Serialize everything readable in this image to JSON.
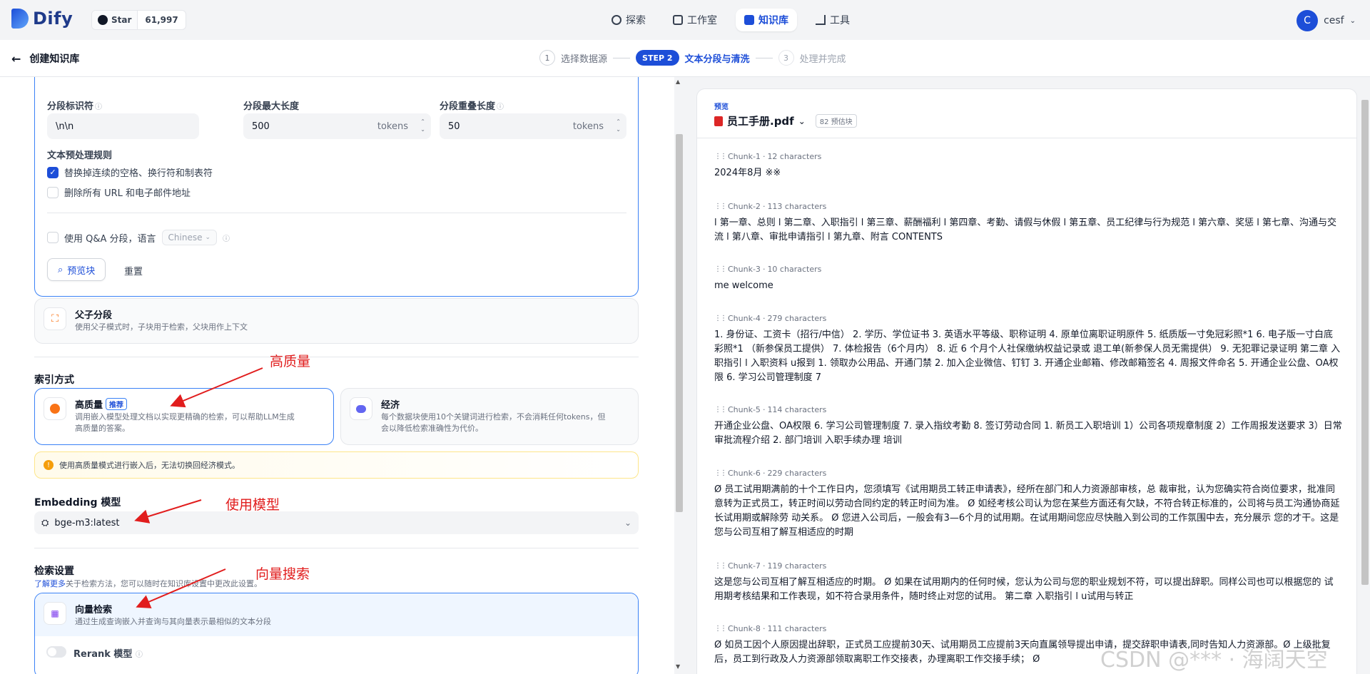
{
  "header": {
    "logo": "Dify",
    "github_star": "Star",
    "github_count": "61,997",
    "nav": [
      {
        "label": "探索",
        "icon": "compass-icon"
      },
      {
        "label": "工作室",
        "icon": "robot-icon"
      },
      {
        "label": "知识库",
        "icon": "book-icon",
        "active": true
      },
      {
        "label": "工具",
        "icon": "hammer-icon"
      }
    ],
    "user_initial": "C",
    "user_name": "cesf"
  },
  "subheader": {
    "back_label": "创建知识库",
    "steps": [
      {
        "num": "1",
        "label": "选择数据源"
      },
      {
        "pill": "STEP 2",
        "label": "文本分段与清洗"
      },
      {
        "num": "3",
        "label": "处理并完成"
      }
    ]
  },
  "segmentation": {
    "delimiter_label": "分段标识符",
    "delimiter_value": "\\n\\n",
    "max_length_label": "分段最大长度",
    "max_length_value": "500",
    "overlap_label": "分段重叠长度",
    "overlap_value": "50",
    "unit": "tokens",
    "rules_title": "文本预处理规则",
    "rule_1": "替换掉连续的空格、换行符和制表符",
    "rule_2": "删除所有 URL 和电子邮件地址",
    "qa_label": "使用 Q&A 分段，语言",
    "qa_lang": "Chinese",
    "preview_button": "预览块",
    "reset_button": "重置"
  },
  "parent_child": {
    "title": "父子分段",
    "desc": "使用父子模式时，子块用于检索，父块用作上下文"
  },
  "index": {
    "section_title": "索引方式",
    "high_title": "高质量",
    "high_badge": "推荐",
    "high_desc_1": "调用嵌入模型处理文档以实现更精确的检索，可以帮助LLM生成",
    "high_desc_2": "高质量的答案。",
    "eco_title": "经济",
    "eco_desc_1": "每个数据块使用10个关键词进行检索，不会消耗任何tokens，但",
    "eco_desc_2": "会以降低检索准确性为代价。",
    "warning": "使用高质量模式进行嵌入后，无法切换回经济模式。"
  },
  "embedding": {
    "section_title": "Embedding 模型",
    "model": "bge-m3:latest"
  },
  "retrieval": {
    "section_title": "检索设置",
    "hint_link": "了解更多",
    "hint_text": "关于检索方法，您可以随时在知识库设置中更改此设置。",
    "vector_title": "向量检索",
    "vector_desc": "通过生成查询嵌入并查询与其向量表示最相似的文本分段",
    "rerank_label": "Rerank 模型"
  },
  "annotations": {
    "high_quality": "高质量",
    "use_model": "使用模型",
    "vector_search": "向量搜索"
  },
  "preview": {
    "tag": "预览",
    "file_name": "员工手册.pdf",
    "chunk_count": "82 预估块",
    "chunks": [
      {
        "id": "Chunk-1",
        "chars": "12 characters",
        "text": "2024年8月 ※※"
      },
      {
        "id": "Chunk-2",
        "chars": "113 characters",
        "text": "l 第一章、总则 l 第二章、入职指引 l 第三章、薪酬福利 l 第四章、考勤、请假与休假 l 第五章、员工纪律与行为规范 l 第六章、奖惩 l 第七章、沟通与交流 l 第八章、审批申请指引 l 第九章、附言 CONTENTS"
      },
      {
        "id": "Chunk-3",
        "chars": "10 characters",
        "text": "me welcome"
      },
      {
        "id": "Chunk-4",
        "chars": "279 characters",
        "text": "1. 身份证、工资卡（招行/中信） 2. 学历、学位证书 3. 英语水平等级、职称证明 4. 原单位离职证明原件 5. 纸质版一寸免冠彩照*1 6. 电子版一寸白底彩照*1 （新参保员工提供） 7. 体检报告（6个月内） 8. 近 6 个月个人社保缴纳权益记录或 退工单(新参保人员无需提供） 9. 无犯罪记录证明 第二章 入职指引 l 入职资料 u报到 1. 领取办公用品、开通门禁 2. 加入企业微信、钉钉 3. 开通企业邮箱、修改邮箱签名 4. 周报文件命名 5. 开通企业公盘、OA权限 6. 学习公司管理制度 7"
      },
      {
        "id": "Chunk-5",
        "chars": "114 characters",
        "text": "开通企业公盘、OA权限 6. 学习公司管理制度 7. 录入指纹考勤 8. 签订劳动合同 1. 新员工入职培训 1）公司各项规章制度 2）工作周报发送要求 3）日常审批流程介绍 2. 部门培训 入职手续办理 培训"
      },
      {
        "id": "Chunk-6",
        "chars": "229 characters",
        "text": "Ø 员工试用期满前的十个工作日内，您须填写《试用期员工转正申请表》，经所在部门和人力资源部审核，总 裁审批，认为您确实符合岗位要求，批准同意转为正式员工，转正时间以劳动合同约定的转正时间为准。 Ø 如经考核公司认为您在某些方面还有欠缺，不符合转正标准的，公司将与员工沟通协商延长试用期或解除劳 动关系。 Ø 您进入公司后，一般会有3—6个月的试用期。在试用期间您应尽快融入到公司的工作氛围中去，充分展示 您的才干。这是您与公司互相了解互相适应的时期"
      },
      {
        "id": "Chunk-7",
        "chars": "119 characters",
        "text": "这是您与公司互相了解互相适应的时期。 Ø 如果在试用期内的任何时候，您认为公司与您的职业规划不符，可以提出辞职。同样公司也可以根据您的 试用期考核结果和工作表现，如不符合录用条件，随时终止对您的试用。 第二章 入职指引 l u试用与转正"
      },
      {
        "id": "Chunk-8",
        "chars": "111 characters",
        "text": "Ø 如员工因个人原因提出辞职，正式员工应提前30天、试用期员工应提前3天向直属领导提出申请，提交辞职申请表,同时告知人力资源部。Ø 上级批复后，员工到行政及人力资源部领取离职工作交接表，办理离职工作交接手续； Ø"
      }
    ]
  },
  "watermark": "CSDN @*** · 海阔天空",
  "colors": {
    "accent": "#1d4ed8",
    "annotation": "#e11d1d",
    "warning": "#f59e0b"
  }
}
